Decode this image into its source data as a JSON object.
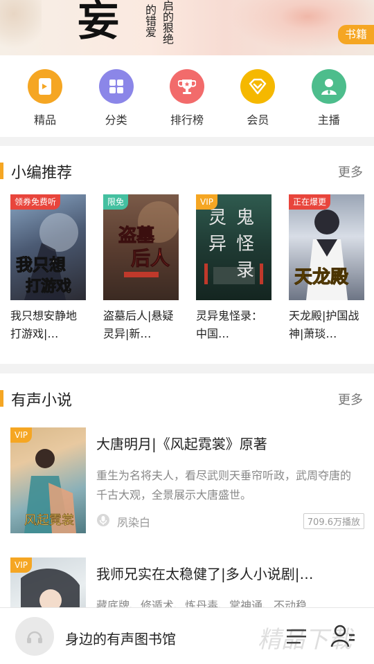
{
  "banner": {
    "big_title": "妄",
    "sub_text_1": "的错爱",
    "sub_text_2": "启的狠绝",
    "tag": "书籍"
  },
  "categories": [
    {
      "label": "精品",
      "icon": "book-icon",
      "color": "#f5a623"
    },
    {
      "label": "分类",
      "icon": "grid-icon",
      "color": "#8b86e8"
    },
    {
      "label": "排行榜",
      "icon": "trophy-icon",
      "color": "#f26b6b"
    },
    {
      "label": "会员",
      "icon": "diamond-icon",
      "color": "#f5b800"
    },
    {
      "label": "主播",
      "icon": "person-icon",
      "color": "#4dbd8c"
    }
  ],
  "recommend": {
    "title": "小编推荐",
    "more": "更多",
    "books": [
      {
        "badge": "领券免费听",
        "badge_color": "#e8453c",
        "title": "我只想安静地打游戏|…",
        "cover_text": "我只想安静地打游戏"
      },
      {
        "badge": "限免",
        "badge_color": "#44c0a0",
        "title": "盗墓后人|悬疑灵异|新…",
        "cover_text": "盗墓后人"
      },
      {
        "badge": "VIP",
        "badge_color": "#f5a623",
        "title": "灵异鬼怪录：中国…",
        "cover_text": "灵异鬼怪录"
      },
      {
        "badge": "正在爆更",
        "badge_color": "#e8453c",
        "title": "天龙殿|护国战神|萧琰…",
        "cover_text": "天龙殿"
      }
    ]
  },
  "audio": {
    "title": "有声小说",
    "more": "更多",
    "items": [
      {
        "badge": "VIP",
        "title": "大唐明月|《风起霓裳》原著",
        "desc": "重生为名将夫人，看尽武则天垂帘听政，武周夺唐的千古大观，全景展示大唐盛世。",
        "author": "夙染白",
        "plays": "709.6万播放"
      },
      {
        "badge": "VIP",
        "title": "我师兄实在太稳健了|多人小说剧|…",
        "desc": "藏底牌、修遁术、炼丹毒、掌神通、不动稳",
        "author": "",
        "plays": ""
      }
    ]
  },
  "bottombar": {
    "text": "身边的有声图书馆",
    "watermark": "精品下载"
  }
}
